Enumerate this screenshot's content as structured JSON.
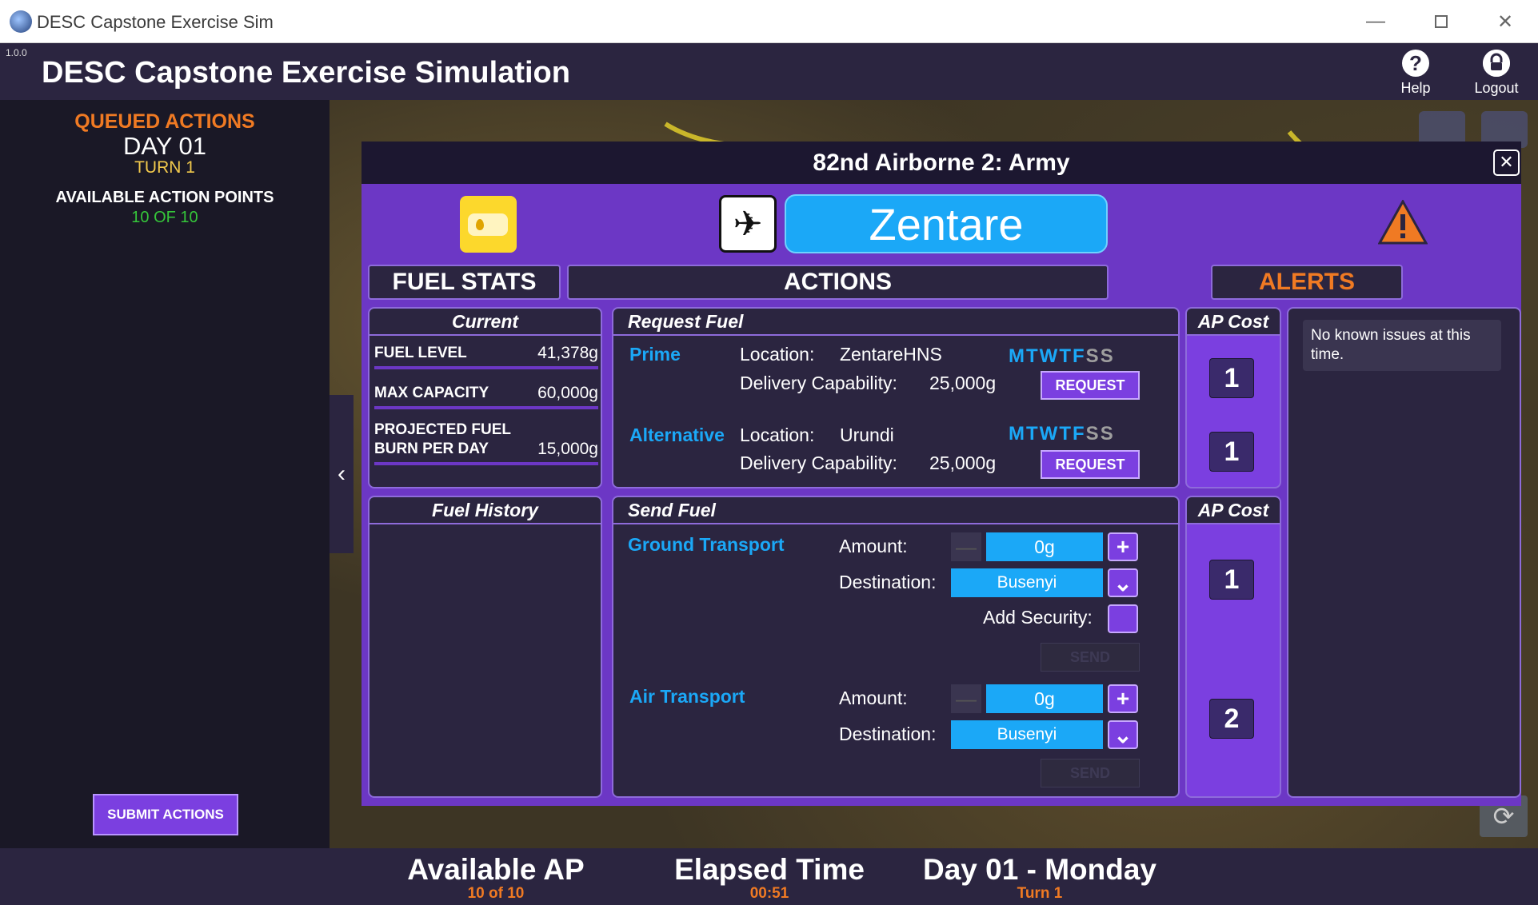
{
  "window": {
    "title": "DESC Capstone Exercise Sim",
    "controls": {
      "minimize": "—",
      "close": "✕"
    }
  },
  "app": {
    "version": "1.0.0",
    "title": "DESC Capstone Exercise Simulation",
    "help_label": "Help",
    "logout_label": "Logout"
  },
  "sidebar": {
    "queued_title": "QUEUED ACTIONS",
    "day": "DAY 01",
    "turn": "TURN 1",
    "ap_label": "AVAILABLE ACTION POINTS",
    "ap_value": "10 OF 10",
    "submit_label": "SUBMIT ACTIONS",
    "collapse_glyph": "‹"
  },
  "modal": {
    "title": "82nd Airborne 2: Army",
    "close_glyph": "✕",
    "location_name": "Zentare",
    "headers": {
      "fuel_stats": "FUEL STATS",
      "actions": "ACTIONS",
      "alerts": "ALERTS"
    },
    "current": {
      "title": "Current",
      "rows": [
        {
          "label": "FUEL LEVEL",
          "value": "41,378g"
        },
        {
          "label": "MAX CAPACITY",
          "value": "60,000g"
        },
        {
          "label": "PROJECTED FUEL BURN PER DAY",
          "value": "15,000g"
        }
      ]
    },
    "fuel_history_title": "Fuel History",
    "request_fuel": {
      "title": "Request Fuel",
      "location_label": "Location:",
      "capability_label": "Delivery Capability:",
      "request_label": "REQUEST",
      "options": [
        {
          "name": "Prime",
          "location": "ZentareHNS",
          "capability": "25,000g",
          "days": [
            "M",
            "T",
            "W",
            "T",
            "F",
            "S",
            "S"
          ],
          "days_active": [
            true,
            true,
            true,
            true,
            true,
            false,
            false
          ]
        },
        {
          "name": "Alternative",
          "location": "Urundi",
          "capability": "25,000g",
          "days": [
            "M",
            "T",
            "W",
            "T",
            "F",
            "S",
            "S"
          ],
          "days_active": [
            true,
            true,
            true,
            true,
            true,
            false,
            false
          ]
        }
      ]
    },
    "ap_cost_title": "AP Cost",
    "request_ap_costs": [
      "1",
      "1"
    ],
    "send_fuel": {
      "title": "Send Fuel",
      "amount_label": "Amount:",
      "destination_label": "Destination:",
      "security_label": "Add Security:",
      "send_label": "SEND",
      "minus_glyph": "—",
      "plus_glyph": "+",
      "dropdown_glyph": "⌄",
      "ground": {
        "name": "Ground Transport",
        "amount": "0g",
        "destination": "Busenyi"
      },
      "air": {
        "name": "Air Transport",
        "amount": "0g",
        "destination": "Busenyi"
      }
    },
    "send_ap_costs": [
      "1",
      "2"
    ],
    "alerts_text": "No known issues at this time."
  },
  "bottom": {
    "available_ap_label": "Available AP",
    "available_ap_value": "10 of 10",
    "elapsed_label": "Elapsed Time",
    "elapsed_value": "00:51",
    "day_label": "Day 01 - Monday",
    "turn_value": "Turn 1"
  },
  "colors": {
    "accent_purple": "#7b3fe0",
    "accent_blue": "#1ba8f7",
    "accent_orange": "#f07a23",
    "ap_green": "#35c63a"
  },
  "icons": [
    "app-icon",
    "help-icon",
    "logout-icon",
    "fuel-drum-icon",
    "airport-icon",
    "warning-icon",
    "checklist-icon",
    "menu-icon",
    "refresh-icon"
  ]
}
